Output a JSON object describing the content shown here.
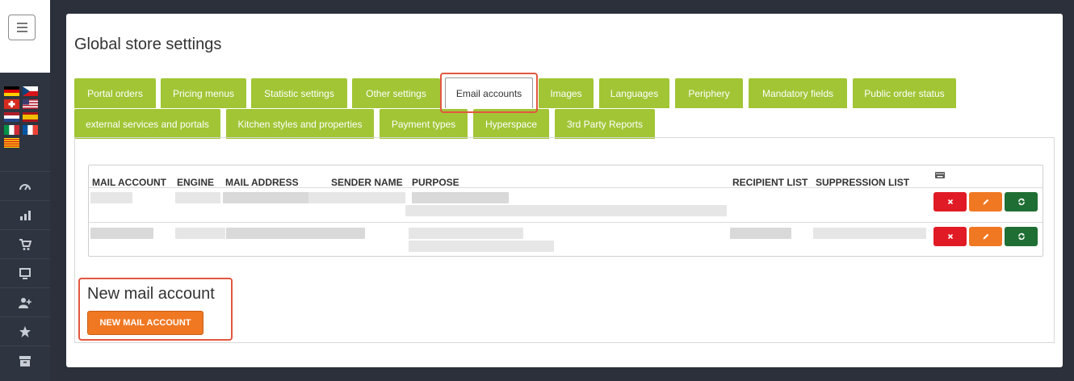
{
  "page": {
    "title": "Global store settings"
  },
  "tabs": [
    {
      "label": "Portal orders",
      "active": false
    },
    {
      "label": "Pricing menus",
      "active": false
    },
    {
      "label": "Statistic settings",
      "active": false
    },
    {
      "label": "Other settings",
      "active": false
    },
    {
      "label": "Email accounts",
      "active": true
    },
    {
      "label": "Images",
      "active": false
    },
    {
      "label": "Languages",
      "active": false
    },
    {
      "label": "Periphery",
      "active": false
    },
    {
      "label": "Mandatory fields",
      "active": false
    },
    {
      "label": "Public order status",
      "active": false
    },
    {
      "label": "external services and portals",
      "active": false
    },
    {
      "label": "Kitchen styles and properties",
      "active": false
    },
    {
      "label": "Payment types",
      "active": false
    },
    {
      "label": "Hyperspace",
      "active": false
    },
    {
      "label": "3rd Party Reports",
      "active": false
    }
  ],
  "table": {
    "columns": [
      "MAIL ACCOUNT",
      "ENGINE",
      "MAIL ADDRESS",
      "SENDER NAME",
      "PURPOSE",
      "RECIPIENT LIST",
      "SUPPRESSION LIST"
    ],
    "actions_icon": "keyboard-icon",
    "row_actions": [
      "delete-icon",
      "edit-icon",
      "sync-icon"
    ]
  },
  "new_account": {
    "heading": "New mail account",
    "button_label": "NEW MAIL ACCOUNT"
  },
  "colors": {
    "tab_green": "#a1c535",
    "highlight": "#e2573f",
    "delete": "#e01b25",
    "edit": "#f07823",
    "sync": "#1f6e33",
    "sidebar": "#2f3540"
  },
  "sidebar": {
    "icons": [
      "dashboard-icon",
      "statistics-icon",
      "cart-icon",
      "monitor-icon",
      "add-user-icon",
      "star-icon",
      "archive-icon"
    ]
  }
}
